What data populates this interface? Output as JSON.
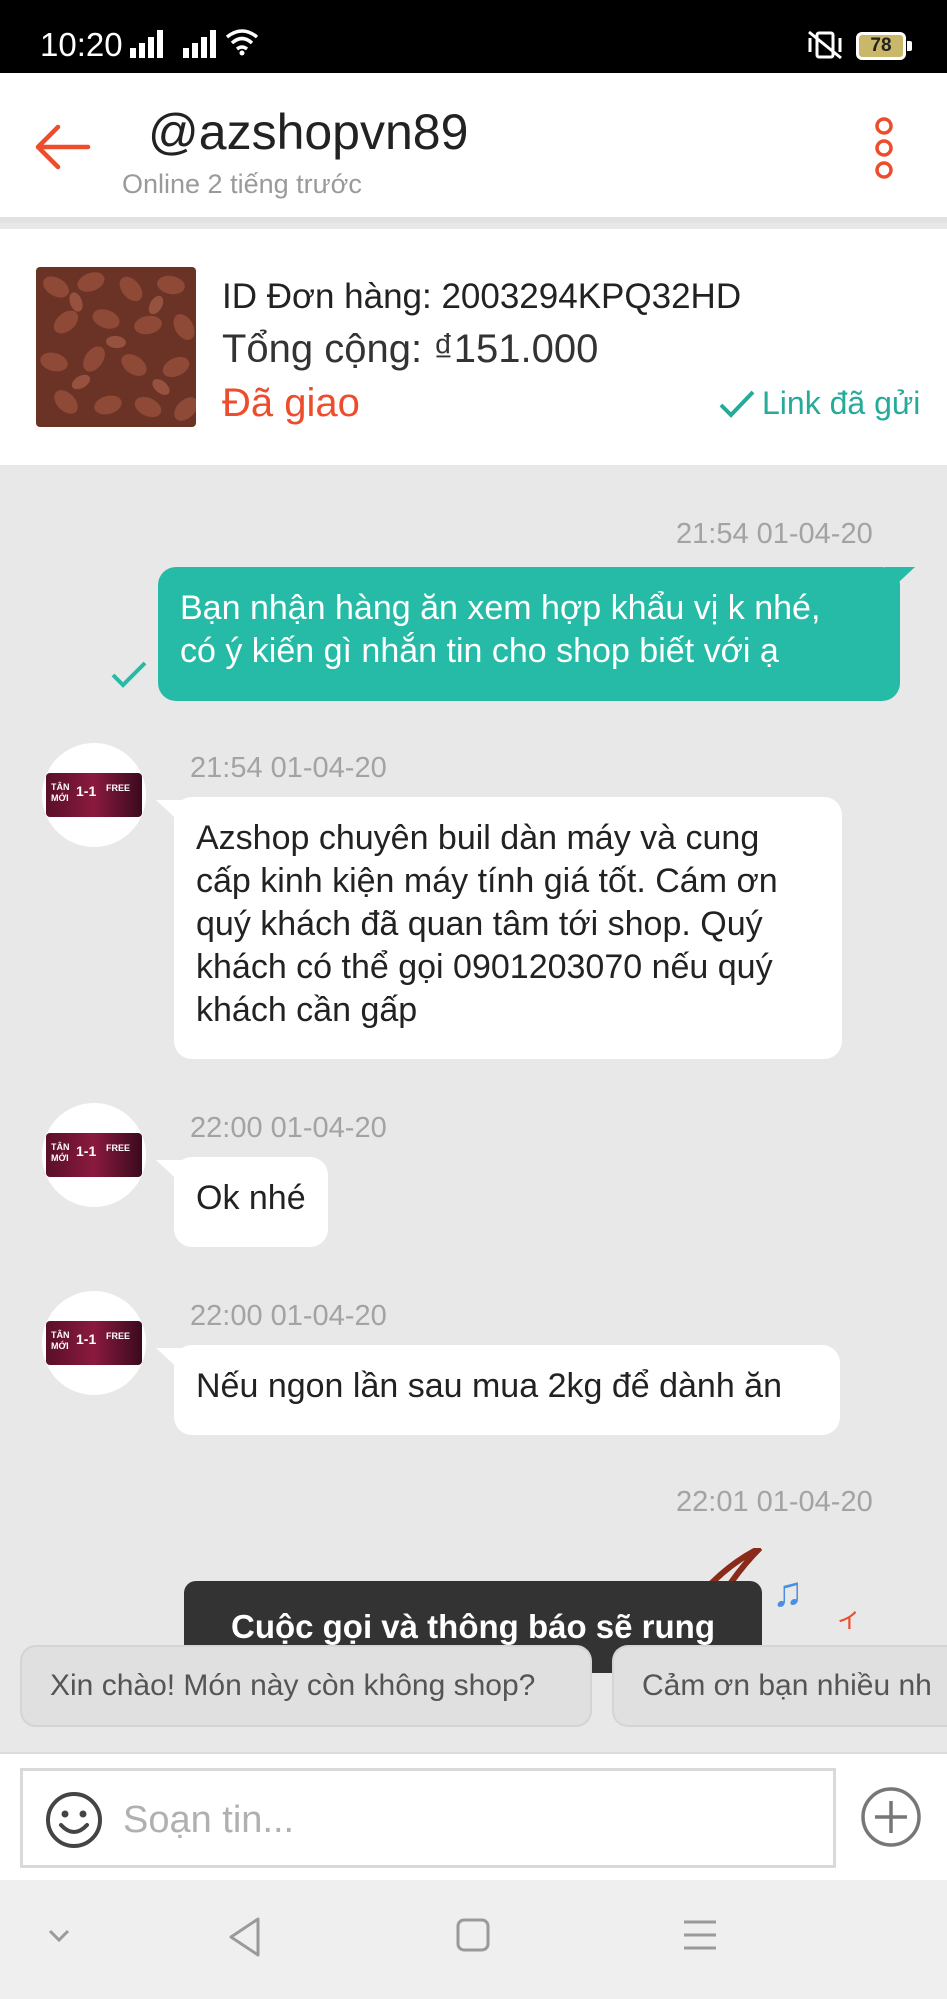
{
  "status_bar": {
    "time": "10:20",
    "battery": "78"
  },
  "header": {
    "title": "@azshopvn89",
    "subtitle": "Online 2 tiếng trước"
  },
  "order": {
    "id_label": "ID Đơn hàng: 2003294KPQ32HD",
    "total_label": "Tổng cộng: ₫151.000",
    "status": "Đã giao",
    "link_status": "Link đã gửi"
  },
  "messages": [
    {
      "time": "21:54 01-04-20",
      "text_lines": [
        "Bạn nhận hàng ăn xem hợp khẩu vị k nhé,",
        "có ý kiến gì nhắn tin cho shop biết với ạ"
      ]
    },
    {
      "time": "21:54 01-04-20",
      "text_lines": [
        "Azshop chuyên buil dàn máy và cung",
        "cấp kinh kiện máy tính giá tốt. Cám ơn",
        "quý khách đã quan tâm tới shop. Quý",
        "khách có thể gọi 0901203070 nếu quý",
        "khách cần gấp"
      ]
    },
    {
      "time": "22:00 01-04-20",
      "text": "Ok nhé"
    },
    {
      "time": "22:00 01-04-20",
      "text": "Nếu ngon lần sau mua 2kg để dành ăn"
    },
    {
      "time": "22:01 01-04-20"
    }
  ],
  "avatar_banner": {
    "line1": "TÂN",
    "line2": "MỚI",
    "big": "1-1",
    "free": "FREE"
  },
  "toast": "Cuộc gọi và thông báo sẽ rung",
  "quick_replies": [
    "Xin chào! Món này còn không shop?",
    "Cảm ơn bạn nhiều nh"
  ],
  "input": {
    "placeholder": "Soạn tin..."
  },
  "colors": {
    "accent": "#ee4d2d",
    "sent_bubble": "#26bba6",
    "teal": "#26aa99"
  }
}
